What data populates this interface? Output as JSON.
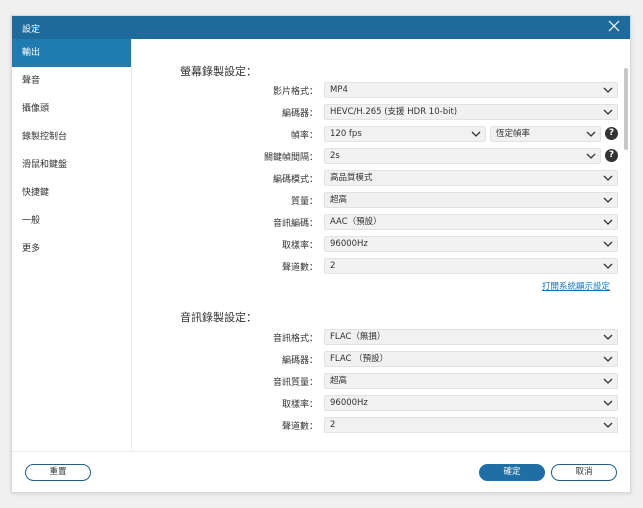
{
  "window": {
    "title": "設定"
  },
  "sidebar": {
    "items": [
      {
        "label": "輸出"
      },
      {
        "label": "聲音"
      },
      {
        "label": "攝像頭"
      },
      {
        "label": "錄製控制台"
      },
      {
        "label": "滑鼠和鍵盤"
      },
      {
        "label": "快捷鍵"
      },
      {
        "label": "一般"
      },
      {
        "label": "更多"
      }
    ],
    "active_index": 0
  },
  "screen_settings": {
    "title": "螢幕錄製設定：",
    "video_format": {
      "label": "影片格式：",
      "value": "MP4"
    },
    "encoder": {
      "label": "編碼器：",
      "value": "HEVC/H.265 (支援 HDR 10-bit)"
    },
    "frame_rate": {
      "label": "幀率：",
      "value": "120 fps",
      "mode": "恆定幀率"
    },
    "keyframe_interval": {
      "label": "關鍵幀間隔：",
      "value": "2s"
    },
    "encoding_mode": {
      "label": "編碼模式：",
      "value": "高品質模式"
    },
    "quality": {
      "label": "質量：",
      "value": "超高"
    },
    "audio_codec": {
      "label": "音訊編碼：",
      "value": "AAC（預設）"
    },
    "sample_rate": {
      "label": "取樣率：",
      "value": "96000Hz"
    },
    "channels": {
      "label": "聲道數：",
      "value": "2"
    },
    "display_settings_link": "打開系統顯示設定"
  },
  "audio_settings": {
    "title": "音訊錄製設定：",
    "audio_format": {
      "label": "音訊格式：",
      "value": "FLAC（無損）"
    },
    "encoder": {
      "label": "編碼器：",
      "value": "FLAC （預設）"
    },
    "audio_quality": {
      "label": "音訊質量：",
      "value": "超高"
    },
    "sample_rate": {
      "label": "取樣率：",
      "value": "96000Hz"
    },
    "channels": {
      "label": "聲道數：",
      "value": "2"
    }
  },
  "footer": {
    "reset_label": "重置",
    "ok_label": "確定",
    "cancel_label": "取消"
  },
  "help_glyph": "?",
  "colors": {
    "titlebar": "#1e6a9a",
    "sidebar_active": "#1f7bb0",
    "primary_button": "#1f6fa6",
    "link": "#1f6fa6"
  }
}
